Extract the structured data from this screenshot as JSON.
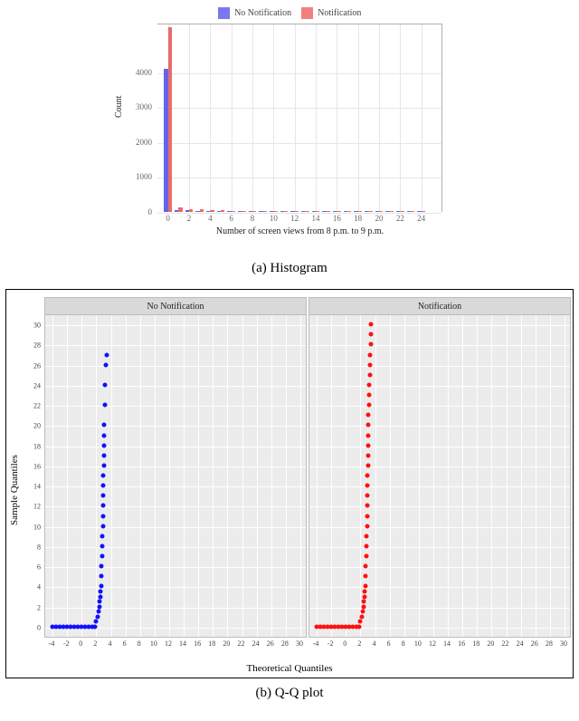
{
  "legend": {
    "a": "No Notification",
    "b": "Notification"
  },
  "captions": {
    "hist": "(a) Histogram",
    "qq": "(b) Q-Q plot"
  },
  "hist": {
    "xlabel": "Number of screen views from 8 p.m. to 9 p.m.",
    "ylabel": "Count",
    "yticks": [
      0,
      1000,
      2000,
      3000,
      4000
    ],
    "xticks": [
      0,
      2,
      4,
      6,
      8,
      10,
      12,
      14,
      16,
      18,
      20,
      22,
      24
    ]
  },
  "qq": {
    "xlabel": "Theoretical Quantiles",
    "ylabel": "Sample Quantiles",
    "strips": {
      "left": "No Notification",
      "right": "Notification"
    },
    "yticks": [
      0,
      2,
      4,
      6,
      8,
      10,
      12,
      14,
      16,
      18,
      20,
      22,
      24,
      26,
      28,
      30
    ],
    "xticks": [
      -4,
      -2,
      0,
      2,
      4,
      6,
      8,
      10,
      12,
      14,
      16,
      18,
      20,
      22,
      24,
      26,
      28,
      30
    ]
  },
  "chart_data": [
    {
      "type": "bar",
      "title": "(a) Histogram",
      "xlabel": "Number of screen views from 8 p.m. to 9 p.m.",
      "ylabel": "Count",
      "ylim": [
        0,
        4500
      ],
      "xlim": [
        0,
        25
      ],
      "series": [
        {
          "name": "No Notification",
          "color": "#7878f0",
          "x": [
            0,
            1,
            2,
            3,
            4,
            5,
            6,
            7,
            8,
            9,
            10,
            11,
            12,
            13,
            14,
            15,
            16,
            17,
            18,
            19,
            20,
            21,
            22,
            23,
            24
          ],
          "values": [
            4100,
            60,
            40,
            30,
            20,
            15,
            12,
            10,
            8,
            6,
            5,
            4,
            3,
            2,
            2,
            2,
            2,
            2,
            2,
            1,
            1,
            1,
            1,
            1,
            1
          ]
        },
        {
          "name": "Notification",
          "color": "#f08080",
          "x": [
            0,
            1,
            2,
            3,
            4,
            5,
            6,
            7,
            8,
            9,
            10,
            11,
            12,
            13,
            14,
            15,
            16,
            17,
            18,
            19,
            20,
            21,
            22,
            23,
            24
          ],
          "values": [
            5300,
            120,
            90,
            70,
            50,
            40,
            30,
            25,
            20,
            18,
            15,
            12,
            10,
            8,
            7,
            6,
            5,
            5,
            4,
            4,
            3,
            3,
            3,
            2,
            2
          ]
        }
      ]
    },
    {
      "type": "scatter",
      "title": "(b) Q-Q plot",
      "facets": [
        "No Notification",
        "Notification"
      ],
      "xlabel": "Theoretical Quantiles",
      "ylabel": "Sample Quantiles",
      "xlim": [
        -5,
        31
      ],
      "ylim": [
        -1,
        31
      ],
      "series": [
        {
          "name": "No Notification",
          "color": "#1010ff",
          "points": [
            [
              -4,
              0
            ],
            [
              -3.5,
              0
            ],
            [
              -3,
              0
            ],
            [
              -2.5,
              0
            ],
            [
              -2,
              0
            ],
            [
              -1.5,
              0
            ],
            [
              -1,
              0
            ],
            [
              -0.5,
              0
            ],
            [
              0,
              0
            ],
            [
              0.5,
              0
            ],
            [
              1,
              0
            ],
            [
              1.5,
              0
            ],
            [
              1.8,
              0
            ],
            [
              2,
              0.5
            ],
            [
              2.2,
              1
            ],
            [
              2.3,
              1.5
            ],
            [
              2.4,
              2
            ],
            [
              2.5,
              2.5
            ],
            [
              2.55,
              3
            ],
            [
              2.6,
              3.5
            ],
            [
              2.65,
              4
            ],
            [
              2.7,
              5
            ],
            [
              2.75,
              6
            ],
            [
              2.8,
              7
            ],
            [
              2.85,
              8
            ],
            [
              2.88,
              9
            ],
            [
              2.9,
              10
            ],
            [
              2.92,
              11
            ],
            [
              2.94,
              12
            ],
            [
              2.96,
              13
            ],
            [
              2.98,
              14
            ],
            [
              3,
              15
            ],
            [
              3.02,
              16
            ],
            [
              3.04,
              17
            ],
            [
              3.06,
              18
            ],
            [
              3.08,
              19
            ],
            [
              3.1,
              20
            ],
            [
              3.15,
              22
            ],
            [
              3.2,
              24
            ],
            [
              3.3,
              26
            ],
            [
              3.4,
              27
            ]
          ]
        },
        {
          "name": "Notification",
          "color": "#ff1010",
          "points": [
            [
              -4,
              0
            ],
            [
              -3.5,
              0
            ],
            [
              -3,
              0
            ],
            [
              -2.5,
              0
            ],
            [
              -2,
              0
            ],
            [
              -1.5,
              0
            ],
            [
              -1,
              0
            ],
            [
              -0.5,
              0
            ],
            [
              0,
              0
            ],
            [
              0.5,
              0
            ],
            [
              1,
              0
            ],
            [
              1.5,
              0
            ],
            [
              1.8,
              0
            ],
            [
              2,
              0.5
            ],
            [
              2.2,
              1
            ],
            [
              2.3,
              1.5
            ],
            [
              2.4,
              2
            ],
            [
              2.5,
              2.5
            ],
            [
              2.55,
              3
            ],
            [
              2.6,
              3.5
            ],
            [
              2.65,
              4
            ],
            [
              2.7,
              5
            ],
            [
              2.75,
              6
            ],
            [
              2.8,
              7
            ],
            [
              2.85,
              8
            ],
            [
              2.88,
              9
            ],
            [
              2.9,
              10
            ],
            [
              2.92,
              11
            ],
            [
              2.94,
              12
            ],
            [
              2.96,
              13
            ],
            [
              2.98,
              14
            ],
            [
              3,
              15
            ],
            [
              3.02,
              16
            ],
            [
              3.04,
              17
            ],
            [
              3.06,
              18
            ],
            [
              3.08,
              19
            ],
            [
              3.1,
              20
            ],
            [
              3.13,
              21
            ],
            [
              3.16,
              22
            ],
            [
              3.2,
              23
            ],
            [
              3.24,
              24
            ],
            [
              3.28,
              25
            ],
            [
              3.32,
              26
            ],
            [
              3.36,
              27
            ],
            [
              3.4,
              28
            ],
            [
              3.45,
              29
            ],
            [
              3.5,
              30
            ]
          ]
        }
      ]
    }
  ]
}
